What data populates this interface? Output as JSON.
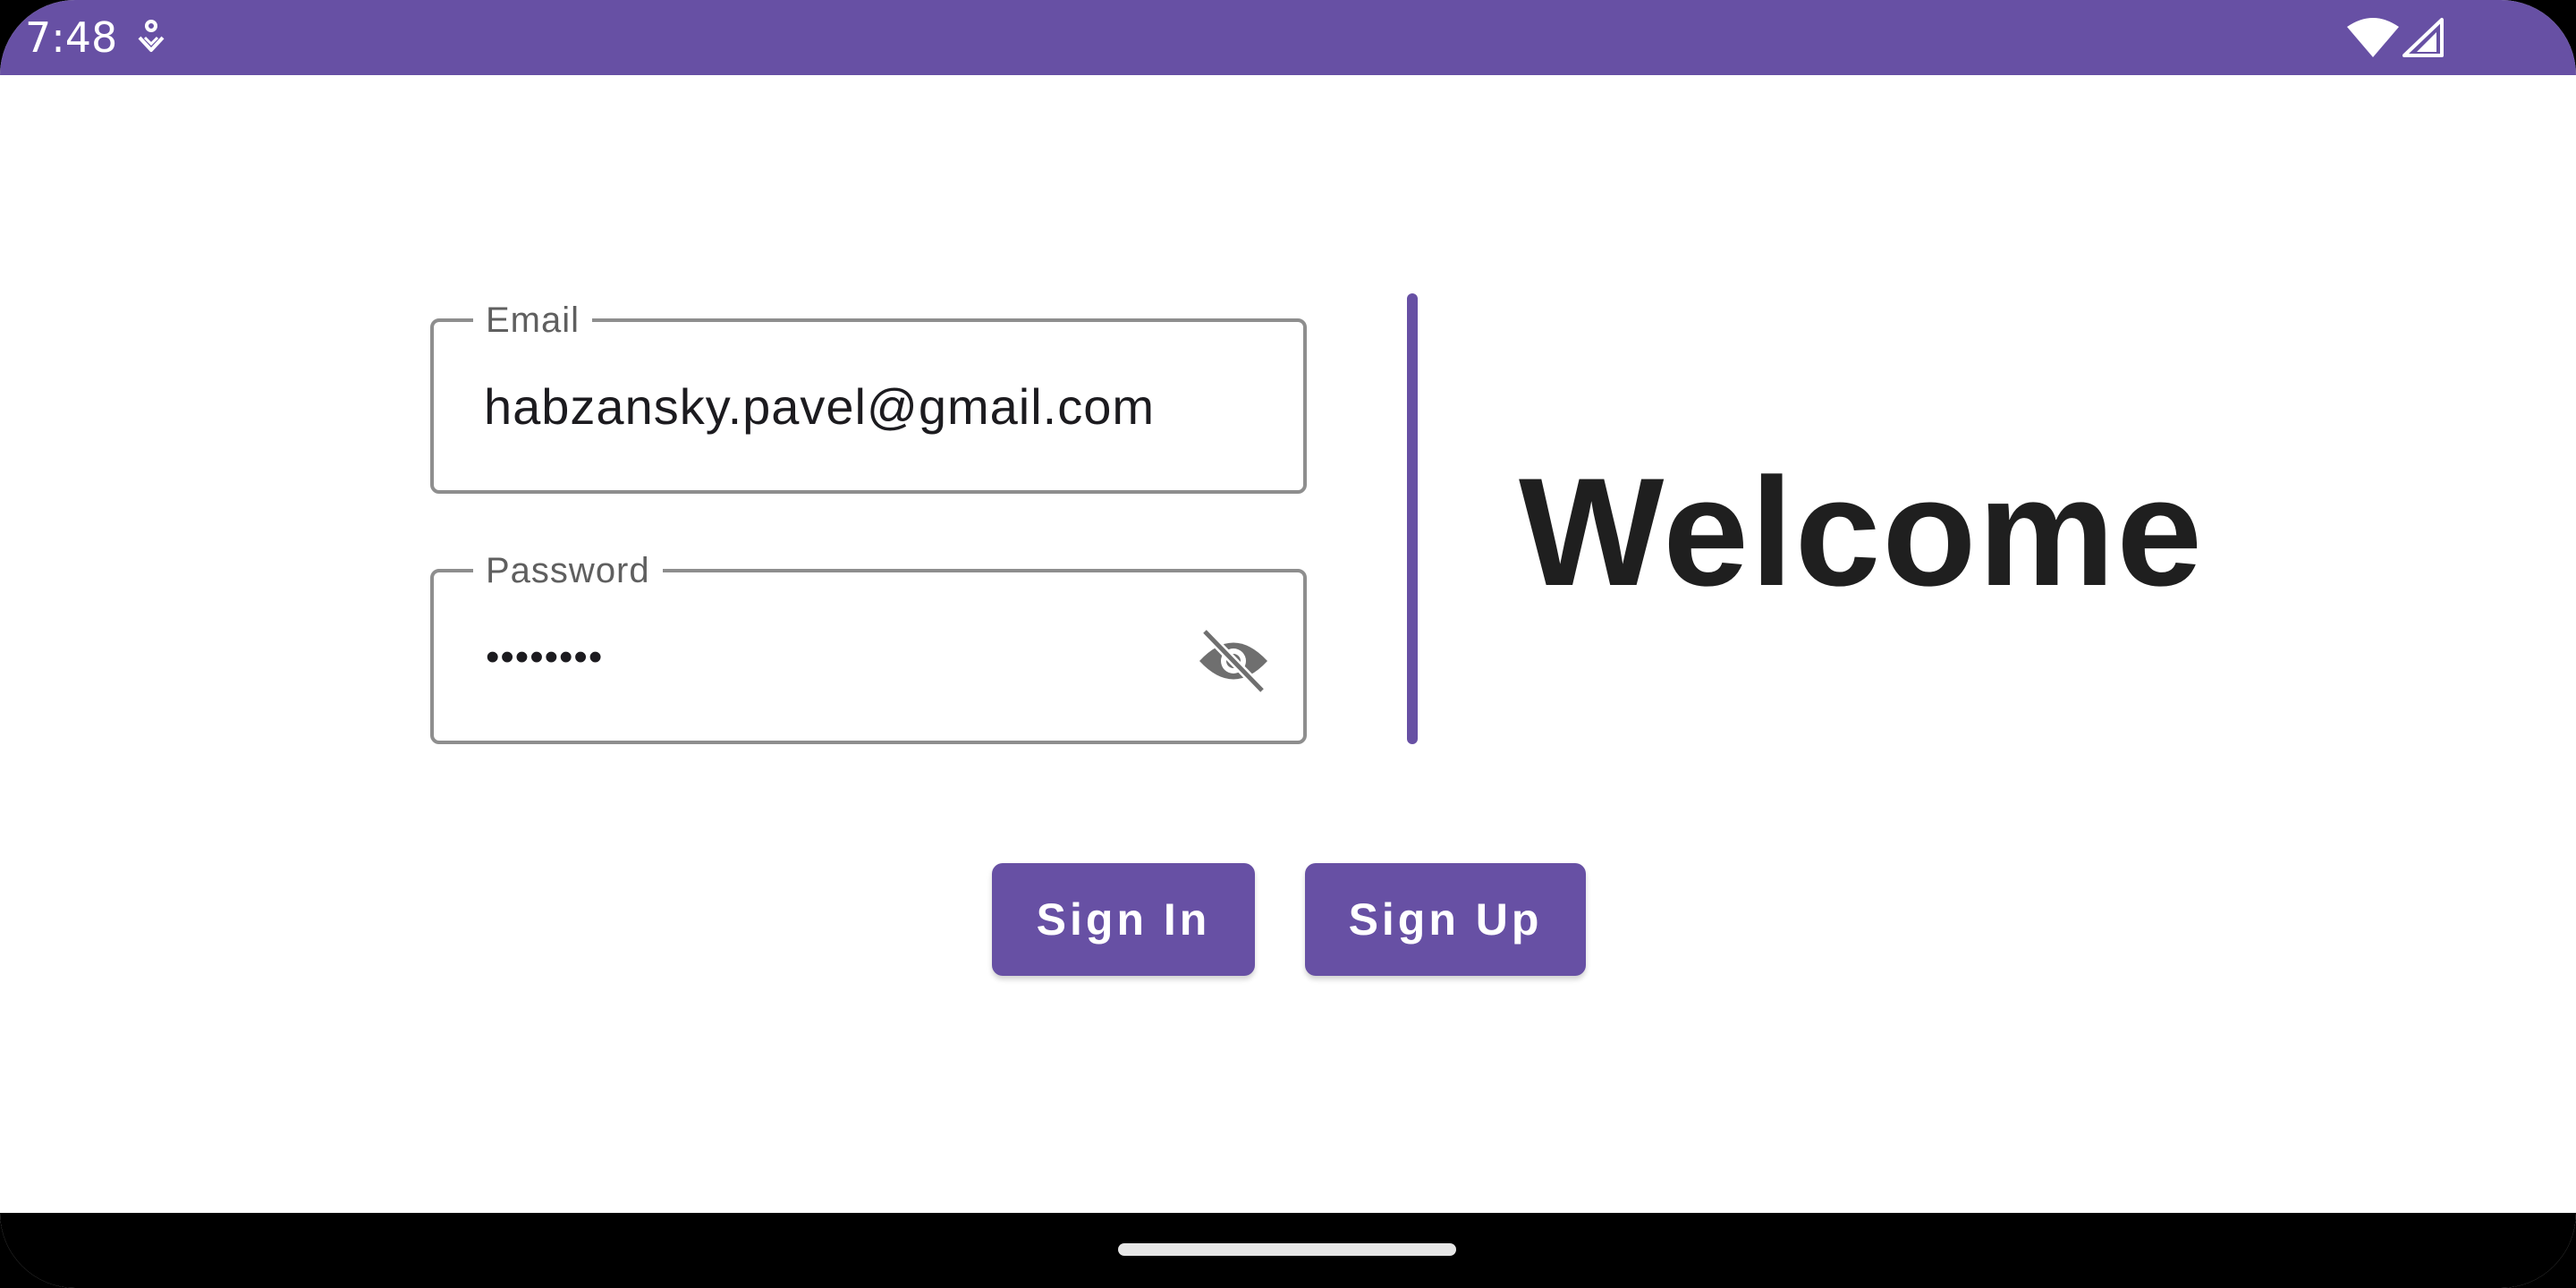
{
  "status_bar": {
    "time": "7:48",
    "background_color": "#6750A4",
    "icons": [
      "notification-icon",
      "wifi-icon",
      "signal-icon"
    ]
  },
  "form": {
    "email": {
      "label": "Email",
      "value": "habzansky.pavel@gmail.com"
    },
    "password": {
      "label": "Password",
      "masked_value": "••••••••",
      "visibility_icon": "visibility-off-icon"
    }
  },
  "welcome": {
    "title": "Welcome"
  },
  "buttons": {
    "sign_in": "Sign In",
    "sign_up": "Sign Up"
  },
  "colors": {
    "accent": "#6750A4",
    "field_border": "#8e8e8e",
    "text": "#1f1f1f"
  }
}
